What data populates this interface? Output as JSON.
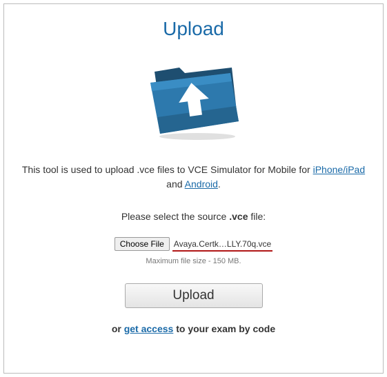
{
  "title": "Upload",
  "icon": "upload-folder-icon",
  "description": {
    "prefix": "This tool is used to upload .vce files to VCE Simulator for Mobile for ",
    "link1": "iPhone/iPad",
    "middle": " and ",
    "link2": "Android",
    "suffix": "."
  },
  "prompt": {
    "prefix": "Please select the source ",
    "bold": ".vce",
    "suffix": " file:"
  },
  "file": {
    "choose_label": "Choose File",
    "selected_name": "Avaya.Certk…LLY.70q.vce",
    "max_size_text": "Maximum file size - 150 MB."
  },
  "upload_button": "Upload",
  "access": {
    "prefix": "or ",
    "link": "get access",
    "suffix": " to your exam by code"
  },
  "colors": {
    "accent": "#1a6aa8",
    "underline": "#b01515"
  }
}
